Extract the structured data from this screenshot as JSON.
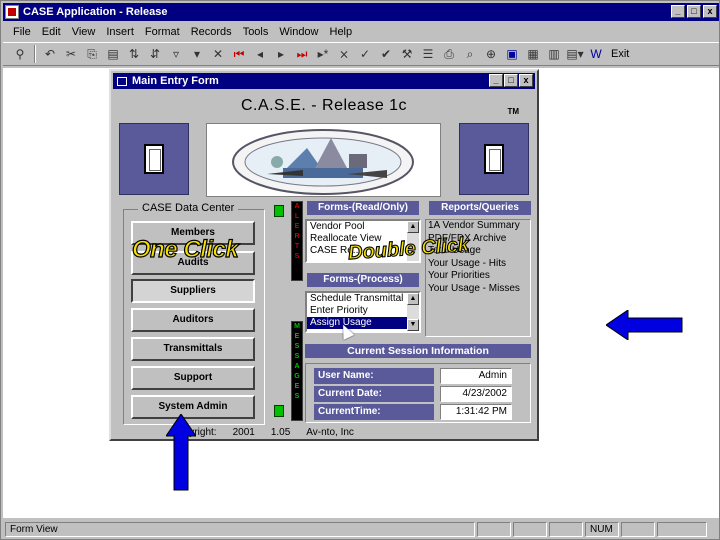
{
  "app": {
    "title": "CASE Application - Release",
    "window_buttons": [
      "_",
      "□",
      "x"
    ],
    "menus": [
      {
        "label": "File",
        "underline": "F"
      },
      {
        "label": "Edit",
        "underline": "E"
      },
      {
        "label": "View",
        "underline": "V"
      },
      {
        "label": "Insert",
        "underline": "I"
      },
      {
        "label": "Format",
        "underline": "o"
      },
      {
        "label": "Records",
        "underline": "R"
      },
      {
        "label": "Tools",
        "underline": "T"
      },
      {
        "label": "Window",
        "underline": "W"
      },
      {
        "label": "Help",
        "underline": "H"
      }
    ],
    "toolbar_exit": "Exit"
  },
  "status": {
    "mode": "Form View",
    "num": "NUM"
  },
  "form": {
    "title": "Main Entry Form",
    "heading": "C.A.S.E. - Release 1c",
    "trademark": "TM",
    "data_center": {
      "title": "CASE Data Center",
      "buttons": [
        "Members",
        "Audits",
        "Suppliers",
        "Auditors",
        "Transmittals",
        "Support",
        "System Admin"
      ]
    },
    "left_bar_letters": [
      "A",
      "L",
      "E",
      "R",
      "T",
      "S"
    ],
    "right_bar_letters": [
      "M",
      "E",
      "S",
      "S",
      "A",
      "G",
      "E",
      "S"
    ],
    "forms_readonly": {
      "title": "Forms-(Read/Only)",
      "items": [
        "Vendor Pool",
        "Reallocate View",
        "CASE Re..."
      ]
    },
    "forms_process": {
      "title": "Forms-(Process)",
      "items": [
        "Schedule Transmittal",
        "Enter Priority",
        "Assign Usage"
      ]
    },
    "reports": {
      "title": "Reports/Queries",
      "items": [
        "1A Vendor Summary",
        "PDF/FDX Archive",
        "Total Usage",
        "Your Usage - Hits",
        "Your Priorities",
        "Your Usage - Misses"
      ]
    },
    "session": {
      "title": "Current Session Information",
      "rows": [
        {
          "label": "User Name:",
          "value": "Admin"
        },
        {
          "label": "Current Date:",
          "value": "4/23/2002"
        },
        {
          "label": "CurrentTime:",
          "value": "1:31:42 PM"
        }
      ]
    },
    "footer": {
      "copyright": "Copyright:",
      "year": "2001",
      "version": "1.05",
      "company": "Av-nto, Inc"
    }
  },
  "annotations": {
    "one_click": "One Click",
    "double_click": "Double Click",
    "arrow_color": "#0000e0",
    "overlay_text_color": "#f5e000"
  }
}
